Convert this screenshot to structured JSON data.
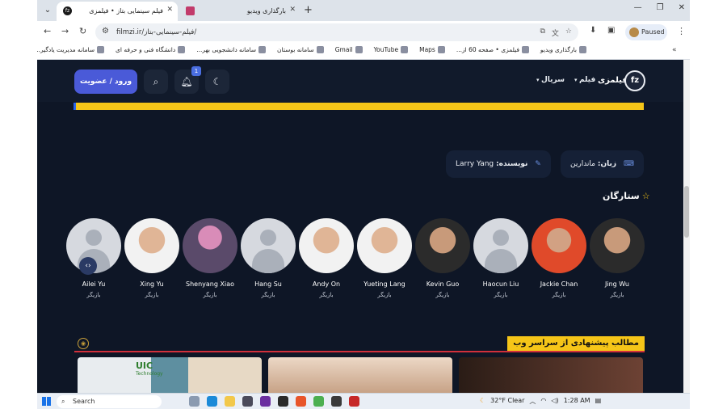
{
  "browser": {
    "tabs": [
      {
        "title": "فیلم سینمایی بتاز • فیلمزی",
        "favicon": "fz",
        "active": true
      },
      {
        "title": "بارگذاری ویدیو",
        "favicon": "",
        "active": false
      }
    ],
    "new_tab": "+",
    "url": "filmzi.ir/فیلم-سینمایی-بتاز/",
    "paused_label": "Paused",
    "bookmarks": [
      "بارگذاری ویدیو",
      "فیلمزی • صفحه 60 از...",
      "Maps",
      "YouTube",
      "Gmail",
      "سامانه بوستان",
      "سامانه دانشجویی بهر...",
      "دانشگاه فنی و حرفه ای",
      "سامانه مدیریت یادگیر..."
    ],
    "more_bookmarks": "»"
  },
  "site": {
    "login_button": "ورود / عضویت",
    "notification_count": "1",
    "nav": [
      "فیلم",
      "سریال"
    ],
    "logo_text": "فیلمزی",
    "logo_mark": "fz",
    "language_key": "زبان:",
    "language_value": "ماندارین",
    "writer_key": "نویسنده:",
    "writer_value": "Larry Yang",
    "stars_title": "ستارگان",
    "cast": [
      {
        "name": "Jing Wu",
        "role": "بازیگر",
        "photo": "photo"
      },
      {
        "name": "Jackie Chan",
        "role": "بازیگر",
        "photo": "bright"
      },
      {
        "name": "Haocun Liu",
        "role": "بازیگر",
        "photo": "placeholder"
      },
      {
        "name": "Kevin Guo",
        "role": "بازیگر",
        "photo": "photo"
      },
      {
        "name": "Yueting Lang",
        "role": "بازیگر",
        "photo": "light"
      },
      {
        "name": "Andy On",
        "role": "بازیگر",
        "photo": "light"
      },
      {
        "name": "Hang Su",
        "role": "بازیگر",
        "photo": "placeholder"
      },
      {
        "name": "Shenyang Xiao",
        "role": "بازیگر",
        "photo": "pink"
      },
      {
        "name": "Xing Yu",
        "role": "بازیگر",
        "photo": "light"
      },
      {
        "name": "Ailei Yu",
        "role": "بازیگر",
        "photo": "placeholder"
      }
    ],
    "suggestions_title": "مطالب پیشنهادی از سراسر وب",
    "card1_label": "UIC",
    "card1_sub": "Technology"
  },
  "taskbar": {
    "search_label": "Search",
    "weather": "32°F  Clear",
    "time": "1:28 AM"
  }
}
